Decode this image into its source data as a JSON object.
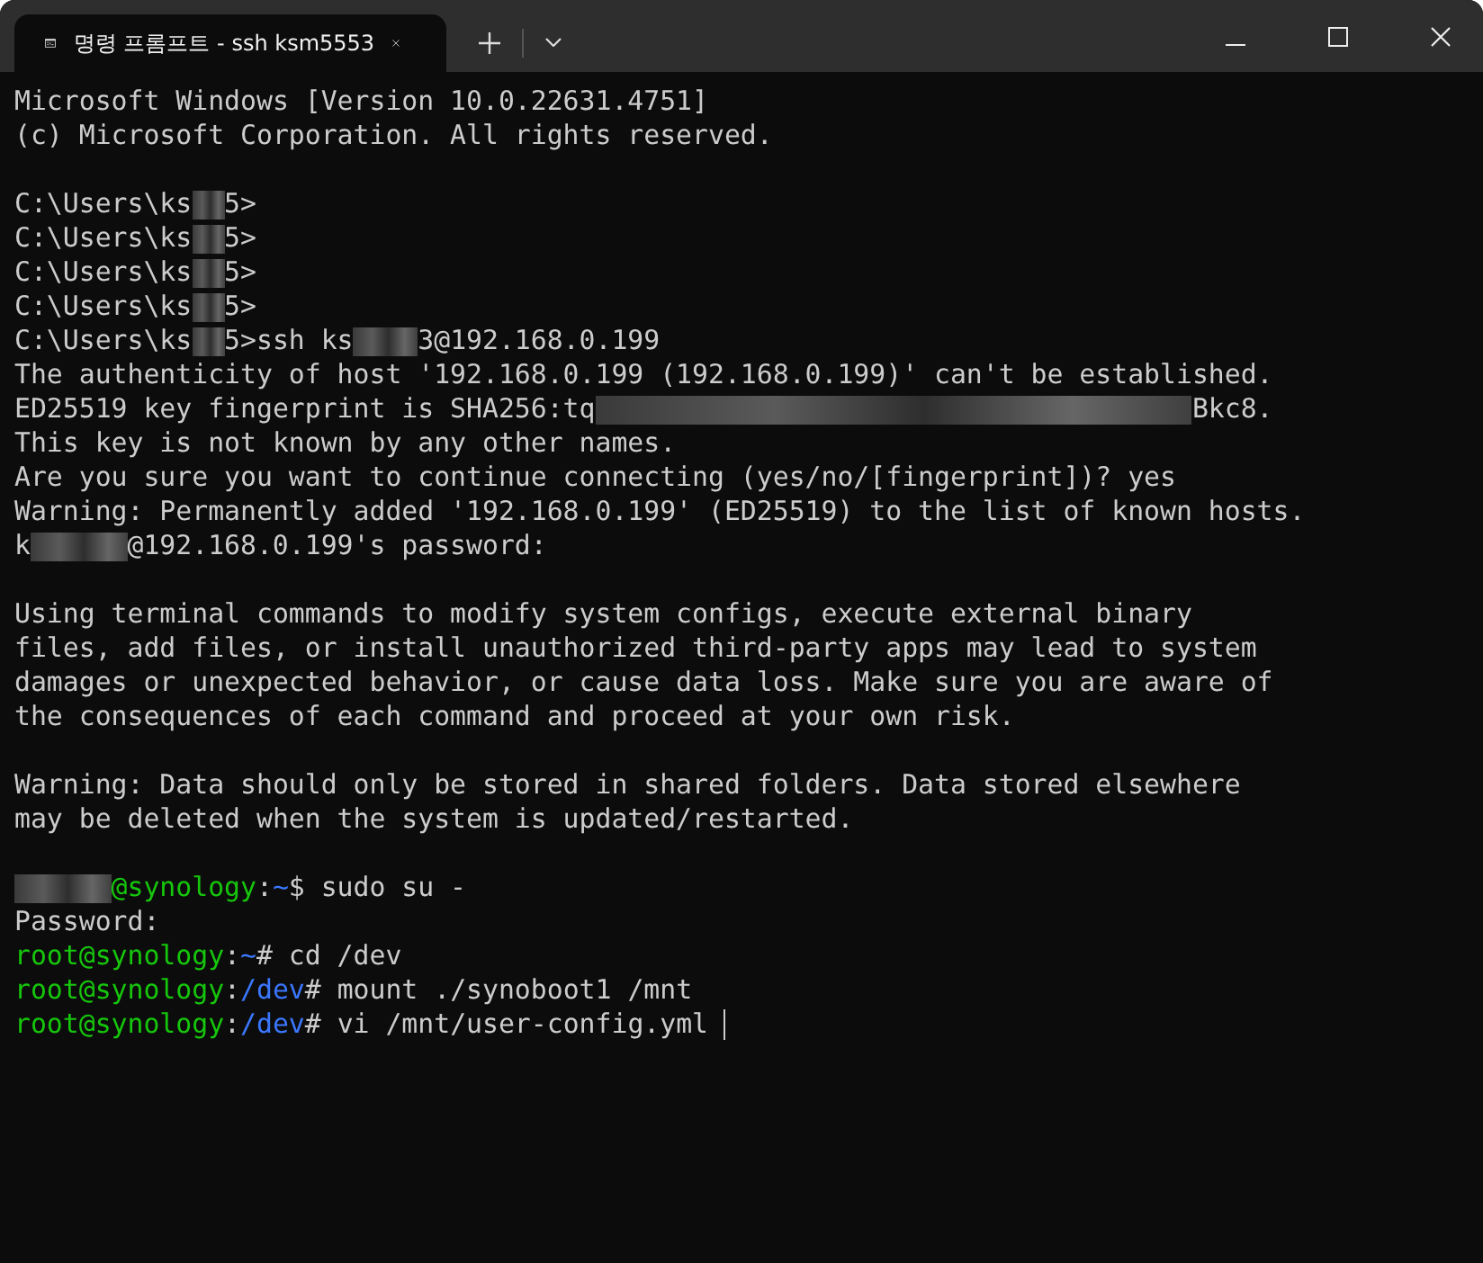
{
  "tab": {
    "title": "명령 프롬프트 - ssh ksm5553",
    "selected": true
  },
  "terminal": {
    "cursor_visible": true,
    "lines": [
      {
        "kind": "text",
        "segments": [
          {
            "kind": "text",
            "text": "Microsoft Windows [Version 10.0.22631.4751]"
          }
        ]
      },
      {
        "kind": "text",
        "segments": [
          {
            "kind": "text",
            "text": "(c) Microsoft Corporation. All rights reserved."
          }
        ]
      },
      {
        "kind": "blank"
      },
      {
        "kind": "text",
        "segments": [
          {
            "kind": "text",
            "text": "C:\\Users\\ks"
          },
          {
            "kind": "mask_short"
          },
          {
            "kind": "text",
            "text": "5>"
          }
        ]
      },
      {
        "kind": "text",
        "segments": [
          {
            "kind": "text",
            "text": "C:\\Users\\ks"
          },
          {
            "kind": "mask_short"
          },
          {
            "kind": "text",
            "text": "5>"
          }
        ]
      },
      {
        "kind": "text",
        "segments": [
          {
            "kind": "text",
            "text": "C:\\Users\\ks"
          },
          {
            "kind": "mask_short"
          },
          {
            "kind": "text",
            "text": "5>"
          }
        ]
      },
      {
        "kind": "text",
        "segments": [
          {
            "kind": "text",
            "text": "C:\\Users\\ks"
          },
          {
            "kind": "mask_short"
          },
          {
            "kind": "text",
            "text": "5>"
          }
        ]
      },
      {
        "kind": "text",
        "segments": [
          {
            "kind": "text",
            "text": "C:\\Users\\ks"
          },
          {
            "kind": "mask_short"
          },
          {
            "kind": "text",
            "text": "5>ssh ks"
          },
          {
            "kind": "mask_medium"
          },
          {
            "kind": "text",
            "text": "3@192.168.0.199"
          }
        ]
      },
      {
        "kind": "text",
        "segments": [
          {
            "kind": "text",
            "text": "The authenticity of host '192.168.0.199 (192.168.0.199)' can't be established."
          }
        ]
      },
      {
        "kind": "text",
        "segments": [
          {
            "kind": "text",
            "text": "ED25519 key fingerprint is SHA256:tq"
          },
          {
            "kind": "mask_long"
          },
          {
            "kind": "text",
            "text": "Bkc8."
          }
        ]
      },
      {
        "kind": "text",
        "segments": [
          {
            "kind": "text",
            "text": "This key is not known by any other names."
          }
        ]
      },
      {
        "kind": "text",
        "segments": [
          {
            "kind": "text",
            "text": "Are you sure you want to continue connecting (yes/no/[fingerprint])? yes"
          }
        ]
      },
      {
        "kind": "text",
        "segments": [
          {
            "kind": "text",
            "text": "Warning: Permanently added '192.168.0.199' (ED25519) to the list of known hosts."
          }
        ]
      },
      {
        "kind": "text",
        "segments": [
          {
            "kind": "text",
            "text": "k"
          },
          {
            "kind": "mask_wide"
          },
          {
            "kind": "text",
            "text": "@192.168.0.199's password:"
          }
        ]
      },
      {
        "kind": "blank"
      },
      {
        "kind": "text",
        "segments": [
          {
            "kind": "text",
            "text": "Using terminal commands to modify system configs, execute external binary"
          }
        ]
      },
      {
        "kind": "text",
        "segments": [
          {
            "kind": "text",
            "text": "files, add files, or install unauthorized third-party apps may lead to system"
          }
        ]
      },
      {
        "kind": "text",
        "segments": [
          {
            "kind": "text",
            "text": "damages or unexpected behavior, or cause data loss. Make sure you are aware of"
          }
        ]
      },
      {
        "kind": "text",
        "segments": [
          {
            "kind": "text",
            "text": "the consequences of each command and proceed at your own risk."
          }
        ]
      },
      {
        "kind": "blank"
      },
      {
        "kind": "text",
        "segments": [
          {
            "kind": "text",
            "text": "Warning: Data should only be stored in shared folders. Data stored elsewhere"
          }
        ]
      },
      {
        "kind": "text",
        "segments": [
          {
            "kind": "text",
            "text": "may be deleted when the system is updated/restarted."
          }
        ]
      },
      {
        "kind": "blank"
      },
      {
        "kind": "text",
        "segments": [
          {
            "kind": "mask_wide"
          },
          {
            "kind": "text",
            "text": "@synology",
            "color": "#16c60c"
          },
          {
            "kind": "text",
            "text": ":"
          },
          {
            "kind": "text",
            "text": "~",
            "color": "#3b78ff"
          },
          {
            "kind": "text",
            "text": "$ sudo su -"
          }
        ]
      },
      {
        "kind": "text",
        "segments": [
          {
            "kind": "text",
            "text": "Password:"
          }
        ]
      },
      {
        "kind": "text",
        "segments": [
          {
            "kind": "text",
            "text": "root@synology",
            "color": "#16c60c"
          },
          {
            "kind": "text",
            "text": ":"
          },
          {
            "kind": "text",
            "text": "~",
            "color": "#3b78ff"
          },
          {
            "kind": "text",
            "text": "# cd /dev"
          }
        ]
      },
      {
        "kind": "text",
        "segments": [
          {
            "kind": "text",
            "text": "root@synology",
            "color": "#16c60c"
          },
          {
            "kind": "text",
            "text": ":"
          },
          {
            "kind": "text",
            "text": "/dev",
            "color": "#3b78ff"
          },
          {
            "kind": "text",
            "text": "# mount ./synoboot1 /mnt"
          }
        ]
      },
      {
        "kind": "text",
        "segments": [
          {
            "kind": "text",
            "text": "root@synology",
            "color": "#16c60c"
          },
          {
            "kind": "text",
            "text": ":"
          },
          {
            "kind": "text",
            "text": "/dev",
            "color": "#3b78ff"
          },
          {
            "kind": "text",
            "text": "# vi /mnt/user-config.yml "
          }
        ]
      }
    ]
  }
}
